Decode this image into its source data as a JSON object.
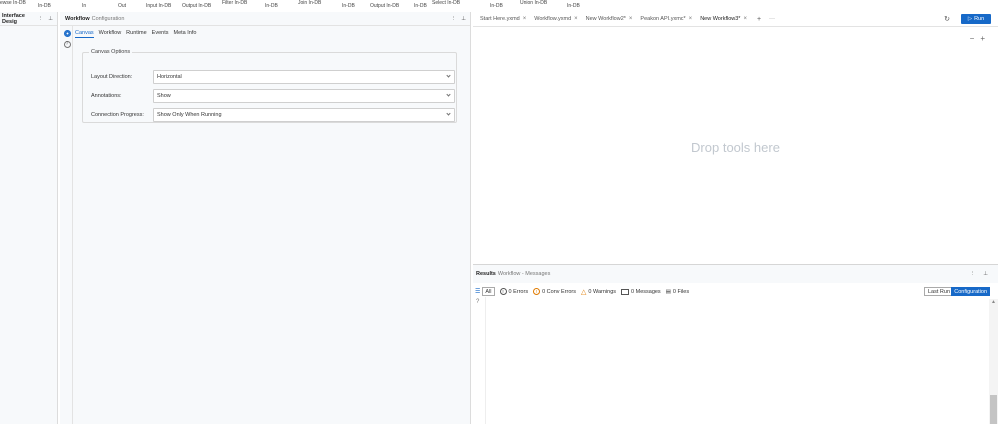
{
  "ribbon": {
    "items": [
      "ewse In-DB",
      "In-DB",
      "In",
      "Out",
      "Input In-DB",
      "Output In-DB",
      "Filter In-DB",
      "In-DB",
      "Join In-DB",
      "In-DB",
      "Output In-DB",
      "In-DB",
      "Select In-DB",
      "In-DB",
      "Union In-DB",
      "In-DB"
    ]
  },
  "interface_panel": {
    "title": "Interface Desig"
  },
  "config": {
    "title": "Workflow",
    "subtitle": "Configuration",
    "tabs": [
      "Canvas",
      "Workflow",
      "Runtime",
      "Events",
      "Meta Info"
    ],
    "active_tab": "Canvas",
    "group_title": "Canvas Options",
    "options": [
      {
        "label": "Layout Direction:",
        "value": "Horizontal"
      },
      {
        "label": "Annotations:",
        "value": "Show"
      },
      {
        "label": "Connection Progress:",
        "value": "Show Only When Running"
      }
    ]
  },
  "canvas": {
    "tabs": [
      {
        "label": "Start Here.yxmd"
      },
      {
        "label": "Workflow.yxmd"
      },
      {
        "label": "New Workflow2*"
      },
      {
        "label": "Peakon API.yxmc*"
      },
      {
        "label": "New Workflow3*"
      }
    ],
    "active_tab": "New Workflow3*",
    "add_tab": "+",
    "more": "···",
    "run_label": "Run",
    "drop_text": "Drop tools here",
    "zoom_out": "−",
    "zoom_in": "+"
  },
  "results": {
    "title": "Results",
    "subtitle": "Workflow - Messages",
    "filters": {
      "all": "All",
      "errors": "0 Errors",
      "conv_errors": "0 Conv Errors",
      "warnings": "0 Warnings",
      "messages": "0 Messages",
      "files": "0 Files"
    },
    "last_run": "Last Run",
    "configuration": "Configuration"
  }
}
